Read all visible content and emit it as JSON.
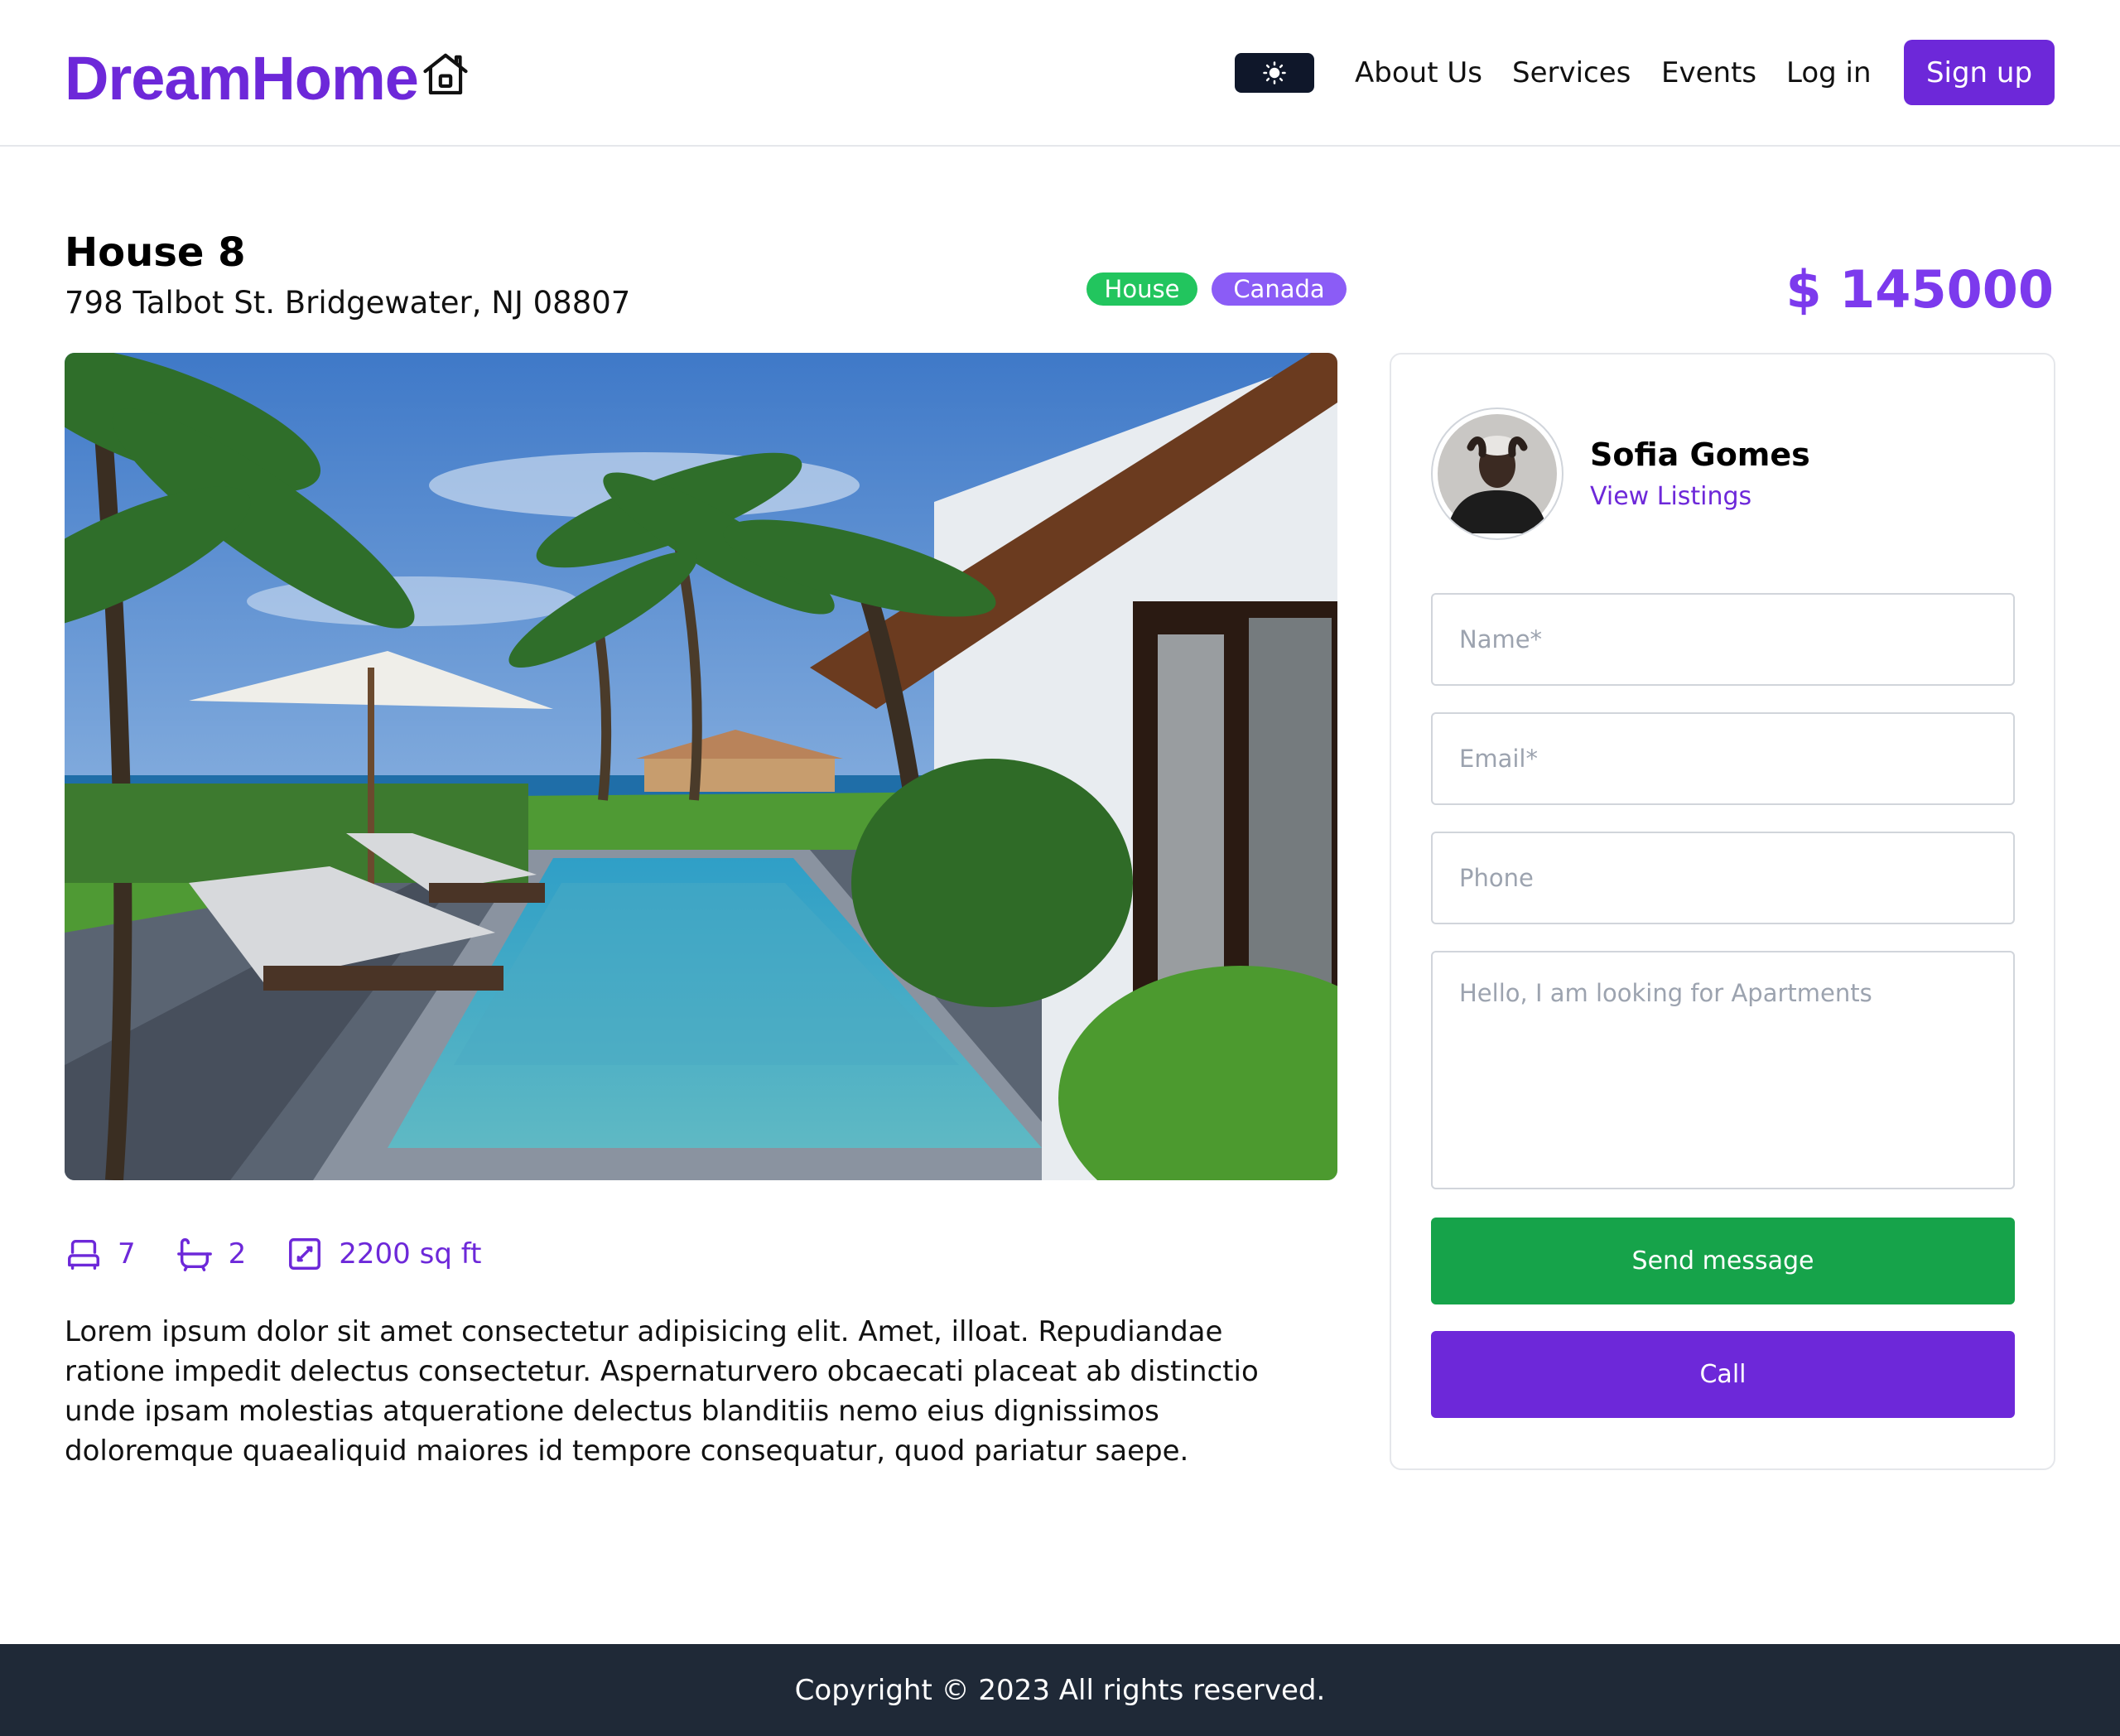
{
  "header": {
    "logo_text": "DreamHome",
    "nav": [
      "About Us",
      "Services",
      "Events",
      "Log in"
    ],
    "signup_label": "Sign up"
  },
  "listing": {
    "title": "House 8",
    "address": "798 Talbot St. Bridgewater, NJ 08807",
    "badges": [
      "House",
      "Canada"
    ],
    "price": "$ 145000",
    "features": {
      "bedrooms": "7",
      "bathrooms": "2",
      "area": "2200 sq ft"
    },
    "description": "Lorem ipsum dolor sit amet consectetur adipisicing elit. Amet, illoat. Repudiandae ratione impedit delectus consectetur. Aspernaturvero obcaecati placeat ab distinctio unde ipsam molestias atqueratione delectus blanditiis nemo eius dignissimos doloremque quaealiquid maiores id tempore consequatur, quod pariatur saepe."
  },
  "agent": {
    "name": "Sofia Gomes",
    "link_label": "View Listings"
  },
  "form": {
    "name_placeholder": "Name*",
    "email_placeholder": "Email*",
    "phone_placeholder": "Phone",
    "message_placeholder": "Hello, I am looking for Apartments",
    "send_label": "Send message",
    "call_label": "Call"
  },
  "footer": {
    "copyright": "Copyright © 2023 All rights reserved."
  },
  "colors": {
    "brand": "#6d28d9",
    "price": "#7c3aed",
    "badge_house": "#22c55e",
    "badge_country": "#8b5cf6",
    "send_button": "#16a34a",
    "footer_bg": "#1f2937",
    "toggle_bg": "#0f172a"
  },
  "icons": [
    "house-icon",
    "sun-icon",
    "bed-icon",
    "bath-icon",
    "area-icon"
  ]
}
